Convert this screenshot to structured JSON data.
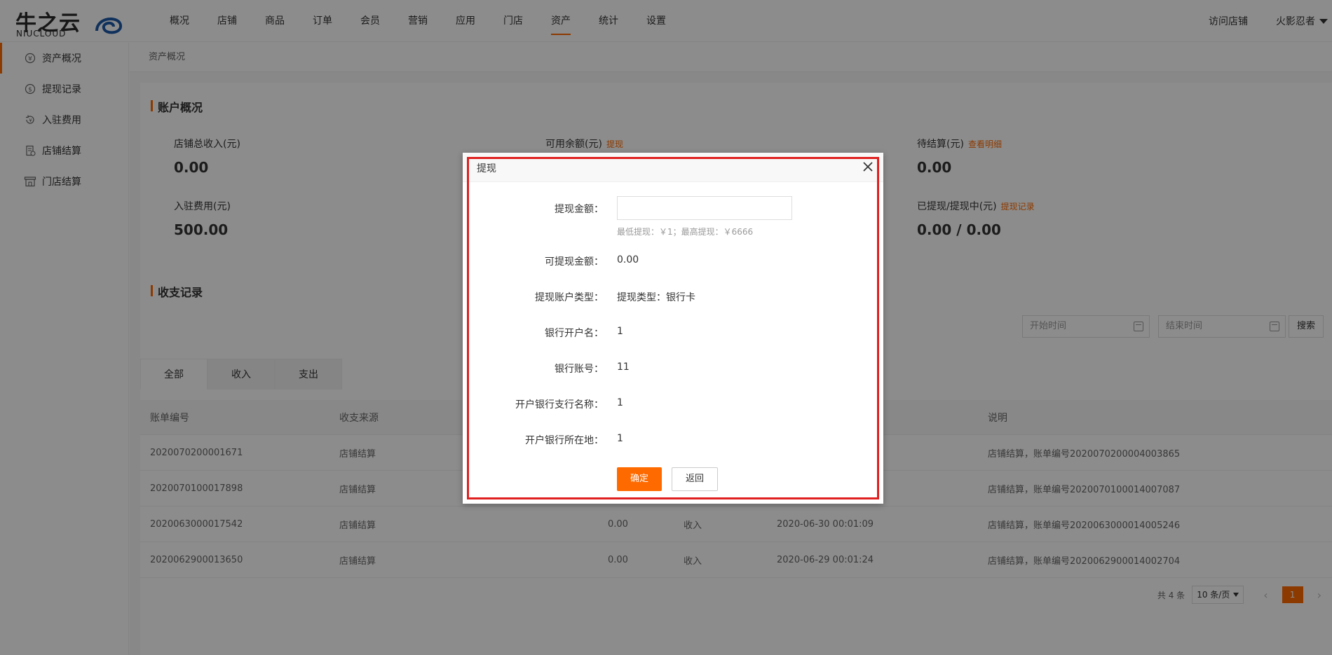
{
  "header": {
    "logo_main": "牛之云",
    "logo_sub": "NIUCLOUD",
    "nav": [
      "概况",
      "店铺",
      "商品",
      "订单",
      "会员",
      "营销",
      "应用",
      "门店",
      "资产",
      "统计",
      "设置"
    ],
    "active_nav": "资产",
    "visit_store": "访问店铺",
    "user_name": "火影忍者"
  },
  "sidebar": {
    "items": [
      {
        "label": "资产概况",
        "icon": "yen-circle-icon"
      },
      {
        "label": "提现记录",
        "icon": "dollar-circle-icon"
      },
      {
        "label": "入驻费用",
        "icon": "refund-icon"
      },
      {
        "label": "店铺结算",
        "icon": "bill-icon"
      },
      {
        "label": "门店结算",
        "icon": "store-icon"
      }
    ]
  },
  "breadcrumb": "资产概况",
  "account": {
    "title": "账户概况",
    "stats": {
      "total_income": {
        "label": "店铺总收入(元)",
        "value": "0.00"
      },
      "available": {
        "label": "可用余额(元)",
        "link": "提现"
      },
      "pending": {
        "label": "待结算(元)",
        "link": "查看明细",
        "value": "0.00"
      },
      "entry_fee": {
        "label": "入驻费用(元)",
        "value": "500.00"
      },
      "withdrawn": {
        "label": "已提现/提现中(元)",
        "link": "提现记录",
        "value": "0.00 / 0.00"
      }
    }
  },
  "records": {
    "title": "收支记录",
    "start_placeholder": "开始时间",
    "end_placeholder": "结束时间",
    "search_label": "搜索",
    "tabs": [
      "全部",
      "收入",
      "支出"
    ],
    "columns": [
      "账单编号",
      "收支来源",
      "说明"
    ],
    "rows": [
      {
        "no": "2020070200001671",
        "source": "店铺结算",
        "amount": "",
        "type": "",
        "time": "",
        "desc": "店铺结算，账单编号2020070200004003865"
      },
      {
        "no": "2020070100017898",
        "source": "店铺结算",
        "amount": "",
        "type": "",
        "time": "",
        "desc": "店铺结算，账单编号2020070100014007087"
      },
      {
        "no": "2020063000017542",
        "source": "店铺结算",
        "amount": "0.00",
        "type": "收入",
        "time": "2020-06-30 00:01:09",
        "desc": "店铺结算，账单编号2020063000014005246"
      },
      {
        "no": "2020062900013650",
        "source": "店铺结算",
        "amount": "0.00",
        "type": "收入",
        "time": "2020-06-29 00:01:24",
        "desc": "店铺结算，账单编号2020062900014002704"
      }
    ],
    "pager": {
      "total": "共 4 条",
      "page_size": "10 条/页",
      "prev": "‹",
      "page": "1",
      "next": "›"
    }
  },
  "dialog": {
    "title": "提现",
    "amount_label": "提现金额：",
    "amount_value": "",
    "amount_tip": "最低提现：￥1；最高提现：￥6666",
    "available_label": "可提现金额：",
    "available_value": "0.00",
    "account_type_label": "提现账户类型：",
    "account_type_value": "提现类型：银行卡",
    "bank_name_label": "银行开户名：",
    "bank_name_value": "1",
    "bank_no_label": "银行账号：",
    "bank_no_value": "11",
    "branch_label": "开户银行支行名称：",
    "branch_value": "1",
    "location_label": "开户银行所在地：",
    "location_value": "1",
    "confirm_label": "确定",
    "back_label": "返回",
    "highlight_color": "#e02020"
  },
  "colors": {
    "accent": "#ff6a00"
  }
}
